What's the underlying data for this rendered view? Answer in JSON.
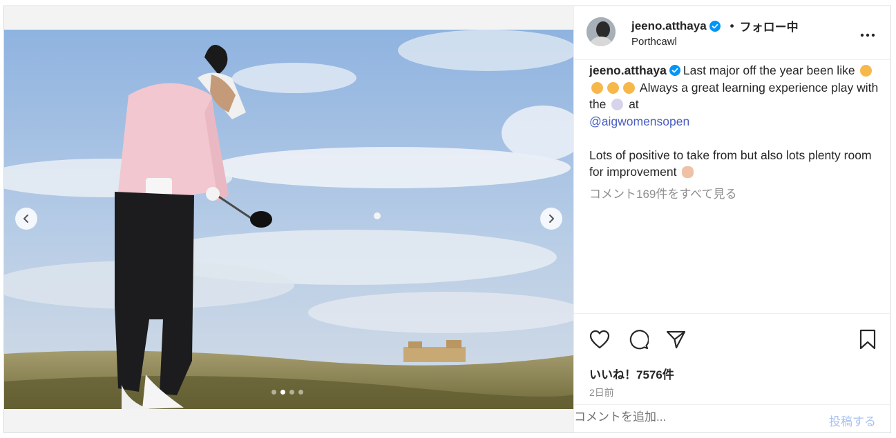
{
  "header": {
    "username": "jeeno.atthaya",
    "separator": "•",
    "follow_status": "フォロー中",
    "location": "Porthcawl"
  },
  "caption": {
    "username": "jeeno.atthaya",
    "text_part1": "Last major off the year been like",
    "text_part2": "Always a great learning experience play with the",
    "text_part3": "at",
    "mention": "@aigwomensopen",
    "text_part4": "Lots of positive to take from but also lots plenty room for improvement"
  },
  "view_all_comments": "コメント169件をすべて見る",
  "likes": "いいね！7576件",
  "time_ago": "2日前",
  "comment": {
    "placeholder": "コメントを追加...",
    "post_label": "投稿する"
  },
  "carousel": {
    "slide_count": 4,
    "active_index": 1
  },
  "colors": {
    "verified": "#0095f6",
    "mention": "#4a5fc1",
    "post_button": "#a8c2f0",
    "muted_text": "#8e8e8e"
  },
  "icons": [
    "verified-icon",
    "more-icon",
    "heart-icon",
    "comment-icon",
    "share-icon",
    "bookmark-icon",
    "chevron-left-icon",
    "chevron-right-icon"
  ]
}
